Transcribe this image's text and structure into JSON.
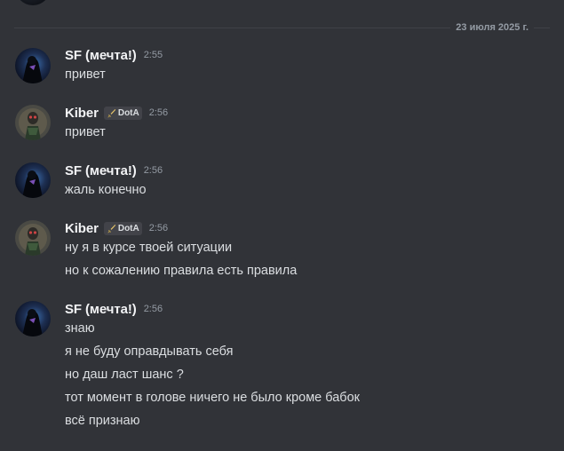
{
  "date_divider": "23 июля 2025 г.",
  "users": {
    "sf": {
      "name": "SF (мечта!)"
    },
    "kiber": {
      "name": "Kiber",
      "tag": "DotA",
      "tag_icon": "sword-icon"
    }
  },
  "messages": [
    {
      "author": "SF (мечта!)",
      "time": "2:55",
      "lines": [
        "привет"
      ]
    },
    {
      "author": "Kiber",
      "tag": "DotA",
      "time": "2:56",
      "lines": [
        "привет"
      ]
    },
    {
      "author": "SF (мечта!)",
      "time": "2:56",
      "lines": [
        "жаль конечно"
      ]
    },
    {
      "author": "Kiber",
      "tag": "DotA",
      "time": "2:56",
      "lines": [
        "ну я в курсе твоей ситуации",
        "но к сожалению правила есть правила"
      ]
    },
    {
      "author": "SF (мечта!)",
      "time": "2:56",
      "lines": [
        "знаю",
        "я не буду оправдывать себя",
        "но даш ласт шанс ?",
        "тот момент в голове ничего не было кроме бабок",
        "всё признаю"
      ]
    }
  ],
  "colors": {
    "background": "#313338",
    "username": "#f2f3f5",
    "text": "#dbdee1",
    "muted": "#949ba4",
    "tag_bg": "#424349"
  }
}
